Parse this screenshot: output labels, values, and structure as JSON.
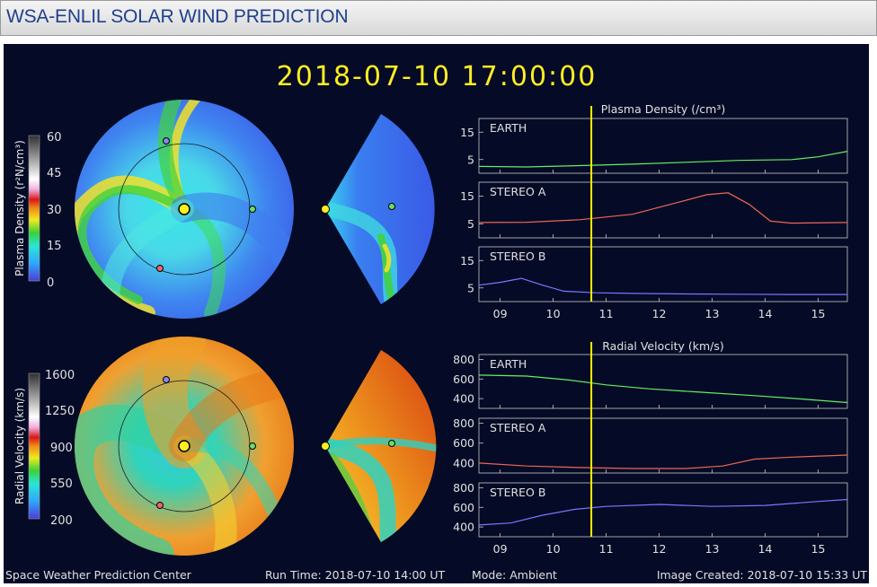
{
  "header": {
    "title": "WSA-ENLIL SOLAR WIND PREDICTION"
  },
  "display": {
    "timestamp": "2018-07-10  17:00:00",
    "mode": "Ambient",
    "footer": {
      "center": "Space Weather Prediction Center",
      "run_time": "Run Time: 2018-07-10 14:00 UT",
      "mode": "Mode: Ambient",
      "created": "Image Created: 2018-07-10 15:33 UT"
    }
  },
  "colorbars": [
    {
      "label": "Plasma Density (r²N/cm³)",
      "ticks": [
        "60",
        "45",
        "30",
        "15",
        "0"
      ],
      "range": [
        0,
        60
      ]
    },
    {
      "label": "Radial Velocity (km/s)",
      "ticks": [
        "1600",
        "1250",
        "900",
        "550",
        "200"
      ],
      "range": [
        200,
        1600
      ]
    }
  ],
  "markers": {
    "sun_color": "#ffee22",
    "earth_color": "#66dd66",
    "stereo_a_color": "#ee6666",
    "stereo_b_color": "#8888ee"
  },
  "chart_data": [
    {
      "type": "line",
      "title": "Plasma Density (/cm³)",
      "x_ticks": [
        "09",
        "10",
        "11",
        "12",
        "13",
        "14",
        "15"
      ],
      "xlim": [
        8.6,
        15.55
      ],
      "current_time_x": 10.72,
      "current_time_color": "#ffee00",
      "panels": [
        {
          "name": "EARTH",
          "color": "#66ee66",
          "y_ticks": [
            5,
            15
          ],
          "ylim": [
            0,
            20
          ],
          "x": [
            8.6,
            9.5,
            10.5,
            11.5,
            12.5,
            13.5,
            14.5,
            15.0,
            15.55
          ],
          "y": [
            2.5,
            2.3,
            2.8,
            3.3,
            4.0,
            4.7,
            5.0,
            6.0,
            8.0
          ]
        },
        {
          "name": "STEREO A",
          "color": "#ee6655",
          "y_ticks": [
            5,
            15
          ],
          "ylim": [
            0,
            20
          ],
          "x": [
            8.6,
            9.5,
            10.5,
            11.5,
            12.3,
            12.9,
            13.3,
            13.7,
            14.1,
            14.5,
            15.55
          ],
          "y": [
            5.5,
            5.6,
            6.5,
            8.5,
            12.5,
            15.5,
            16.2,
            12.0,
            6.0,
            5.3,
            5.5
          ]
        },
        {
          "name": "STEREO B",
          "color": "#7777ff",
          "y_ticks": [
            5,
            15
          ],
          "ylim": [
            0,
            20
          ],
          "x": [
            8.6,
            9.0,
            9.4,
            9.8,
            10.2,
            10.8,
            11.5,
            12.5,
            13.5,
            14.5,
            15.55
          ],
          "y": [
            6.0,
            7.0,
            8.5,
            6.0,
            3.8,
            3.2,
            3.0,
            2.8,
            2.7,
            2.6,
            2.6
          ]
        }
      ]
    },
    {
      "type": "line",
      "title": "Radial Velocity (km/s)",
      "x_ticks": [
        "09",
        "10",
        "11",
        "12",
        "13",
        "14",
        "15"
      ],
      "xlim": [
        8.6,
        15.55
      ],
      "current_time_x": 10.72,
      "current_time_color": "#ffee00",
      "panels": [
        {
          "name": "EARTH",
          "color": "#66ee66",
          "y_ticks": [
            400,
            600,
            800
          ],
          "ylim": [
            300,
            850
          ],
          "x": [
            8.6,
            9.5,
            10.3,
            11.0,
            11.8,
            12.8,
            13.8,
            14.7,
            15.55
          ],
          "y": [
            640,
            630,
            590,
            540,
            500,
            465,
            430,
            395,
            360
          ]
        },
        {
          "name": "STEREO A",
          "color": "#ee6655",
          "y_ticks": [
            400,
            600,
            800
          ],
          "ylim": [
            300,
            850
          ],
          "x": [
            8.6,
            9.5,
            10.5,
            11.5,
            12.5,
            13.2,
            13.8,
            14.5,
            15.55
          ],
          "y": [
            400,
            370,
            355,
            345,
            345,
            370,
            440,
            460,
            480
          ]
        },
        {
          "name": "STEREO B",
          "color": "#7777ff",
          "y_ticks": [
            400,
            600,
            800
          ],
          "ylim": [
            300,
            850
          ],
          "x": [
            8.6,
            9.2,
            9.8,
            10.4,
            11.0,
            12.0,
            13.0,
            14.0,
            15.0,
            15.55
          ],
          "y": [
            420,
            440,
            520,
            580,
            610,
            630,
            610,
            620,
            660,
            680
          ]
        }
      ]
    }
  ]
}
